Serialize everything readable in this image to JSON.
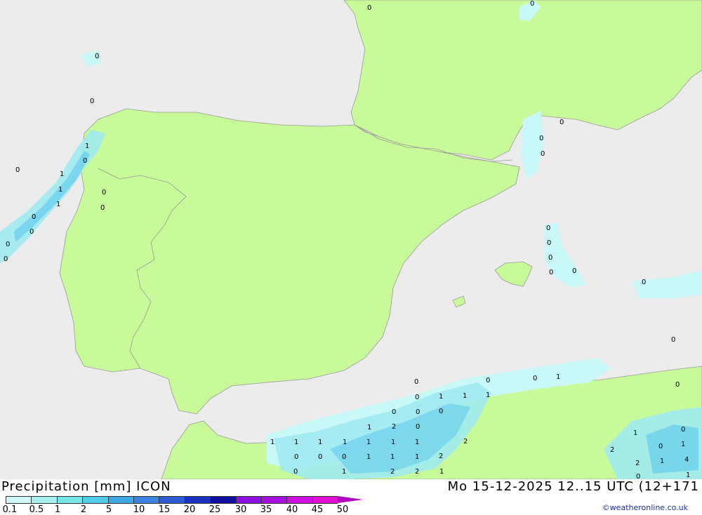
{
  "header": {
    "title": "Precipitation [mm]  ICON",
    "datetime": "Mo 15-12-2025 12..15 UTC (12+171",
    "credit": "©weatheronline.co.uk"
  },
  "legend": {
    "labels": [
      "0.1",
      "0.5",
      "1",
      "2",
      "5",
      "10",
      "15",
      "20",
      "25",
      "30",
      "35",
      "40",
      "45",
      "50"
    ],
    "colors": [
      "#d0f8f8",
      "#a8f0f0",
      "#78e6e6",
      "#50cce8",
      "#3ea8e4",
      "#3c82e0",
      "#2d5ad2",
      "#1e32c0",
      "#0f0fa0",
      "#8c10e0",
      "#a810e0",
      "#d010e0",
      "#e210d0",
      "#b000c0"
    ]
  },
  "map_colors": {
    "sea": "#ececec",
    "land": "#c8fa9a",
    "border": "#999999",
    "precip_light": "#c8f8f8",
    "precip_mid": "#a0eaf0",
    "precip_strong": "#5cc8ec"
  },
  "values": [
    {
      "t": "0"
    },
    {
      "t": "0"
    },
    {
      "t": "0"
    },
    {
      "t": "0"
    },
    {
      "t": "1"
    },
    {
      "t": "0"
    },
    {
      "t": "0"
    },
    {
      "t": "1"
    },
    {
      "t": "1"
    },
    {
      "t": "0"
    },
    {
      "t": "1"
    },
    {
      "t": "0"
    },
    {
      "t": "0"
    },
    {
      "t": "0"
    },
    {
      "t": "0"
    },
    {
      "t": "0"
    },
    {
      "t": "0"
    },
    {
      "t": "0"
    },
    {
      "t": "0"
    },
    {
      "t": "0"
    },
    {
      "t": "0"
    },
    {
      "t": "0"
    },
    {
      "t": "0"
    },
    {
      "t": "0"
    },
    {
      "t": "0"
    },
    {
      "t": "0"
    },
    {
      "t": "0"
    },
    {
      "t": "0"
    },
    {
      "t": "0"
    },
    {
      "t": "1"
    },
    {
      "t": "0"
    },
    {
      "t": "0"
    },
    {
      "t": "1"
    },
    {
      "t": "1"
    },
    {
      "t": "1"
    },
    {
      "t": "0"
    },
    {
      "t": "0"
    },
    {
      "t": "0"
    },
    {
      "t": "1"
    },
    {
      "t": "2"
    },
    {
      "t": "0"
    },
    {
      "t": "1"
    },
    {
      "t": "0"
    },
    {
      "t": "1"
    },
    {
      "t": "1"
    },
    {
      "t": "1"
    },
    {
      "t": "1"
    },
    {
      "t": "1"
    },
    {
      "t": "1"
    },
    {
      "t": "1"
    },
    {
      "t": "2"
    },
    {
      "t": "0"
    },
    {
      "t": "1"
    },
    {
      "t": "2"
    },
    {
      "t": "0"
    },
    {
      "t": "0"
    },
    {
      "t": "0"
    },
    {
      "t": "1"
    },
    {
      "t": "1"
    },
    {
      "t": "1"
    },
    {
      "t": "2"
    },
    {
      "t": "1"
    },
    {
      "t": "4"
    },
    {
      "t": "2"
    },
    {
      "t": "0"
    },
    {
      "t": "1"
    },
    {
      "t": "2"
    },
    {
      "t": "2"
    },
    {
      "t": "1"
    },
    {
      "t": "0"
    },
    {
      "t": "1"
    }
  ]
}
